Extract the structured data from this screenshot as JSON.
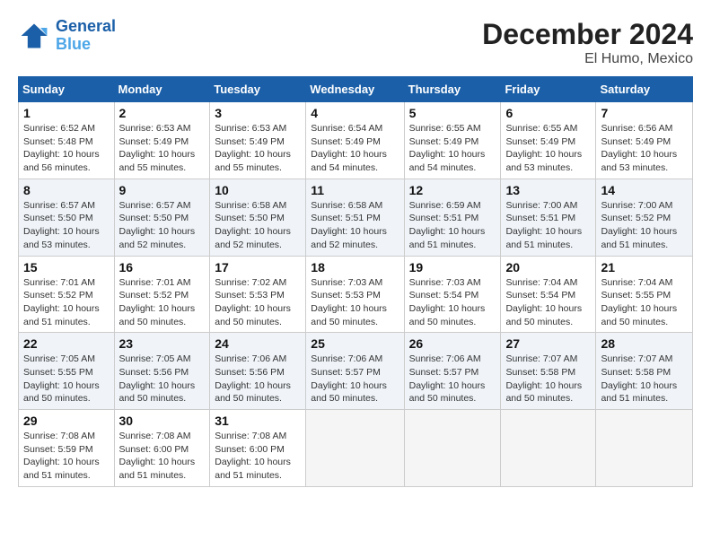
{
  "header": {
    "logo_line1": "General",
    "logo_line2": "Blue",
    "title": "December 2024",
    "subtitle": "El Humo, Mexico"
  },
  "days_of_week": [
    "Sunday",
    "Monday",
    "Tuesday",
    "Wednesday",
    "Thursday",
    "Friday",
    "Saturday"
  ],
  "weeks": [
    [
      {
        "day": 1,
        "sunrise": "6:52 AM",
        "sunset": "5:48 PM",
        "daylight": "10 hours and 56 minutes."
      },
      {
        "day": 2,
        "sunrise": "6:53 AM",
        "sunset": "5:49 PM",
        "daylight": "10 hours and 55 minutes."
      },
      {
        "day": 3,
        "sunrise": "6:53 AM",
        "sunset": "5:49 PM",
        "daylight": "10 hours and 55 minutes."
      },
      {
        "day": 4,
        "sunrise": "6:54 AM",
        "sunset": "5:49 PM",
        "daylight": "10 hours and 54 minutes."
      },
      {
        "day": 5,
        "sunrise": "6:55 AM",
        "sunset": "5:49 PM",
        "daylight": "10 hours and 54 minutes."
      },
      {
        "day": 6,
        "sunrise": "6:55 AM",
        "sunset": "5:49 PM",
        "daylight": "10 hours and 53 minutes."
      },
      {
        "day": 7,
        "sunrise": "6:56 AM",
        "sunset": "5:49 PM",
        "daylight": "10 hours and 53 minutes."
      }
    ],
    [
      {
        "day": 8,
        "sunrise": "6:57 AM",
        "sunset": "5:50 PM",
        "daylight": "10 hours and 53 minutes."
      },
      {
        "day": 9,
        "sunrise": "6:57 AM",
        "sunset": "5:50 PM",
        "daylight": "10 hours and 52 minutes."
      },
      {
        "day": 10,
        "sunrise": "6:58 AM",
        "sunset": "5:50 PM",
        "daylight": "10 hours and 52 minutes."
      },
      {
        "day": 11,
        "sunrise": "6:58 AM",
        "sunset": "5:51 PM",
        "daylight": "10 hours and 52 minutes."
      },
      {
        "day": 12,
        "sunrise": "6:59 AM",
        "sunset": "5:51 PM",
        "daylight": "10 hours and 51 minutes."
      },
      {
        "day": 13,
        "sunrise": "7:00 AM",
        "sunset": "5:51 PM",
        "daylight": "10 hours and 51 minutes."
      },
      {
        "day": 14,
        "sunrise": "7:00 AM",
        "sunset": "5:52 PM",
        "daylight": "10 hours and 51 minutes."
      }
    ],
    [
      {
        "day": 15,
        "sunrise": "7:01 AM",
        "sunset": "5:52 PM",
        "daylight": "10 hours and 51 minutes."
      },
      {
        "day": 16,
        "sunrise": "7:01 AM",
        "sunset": "5:52 PM",
        "daylight": "10 hours and 50 minutes."
      },
      {
        "day": 17,
        "sunrise": "7:02 AM",
        "sunset": "5:53 PM",
        "daylight": "10 hours and 50 minutes."
      },
      {
        "day": 18,
        "sunrise": "7:03 AM",
        "sunset": "5:53 PM",
        "daylight": "10 hours and 50 minutes."
      },
      {
        "day": 19,
        "sunrise": "7:03 AM",
        "sunset": "5:54 PM",
        "daylight": "10 hours and 50 minutes."
      },
      {
        "day": 20,
        "sunrise": "7:04 AM",
        "sunset": "5:54 PM",
        "daylight": "10 hours and 50 minutes."
      },
      {
        "day": 21,
        "sunrise": "7:04 AM",
        "sunset": "5:55 PM",
        "daylight": "10 hours and 50 minutes."
      }
    ],
    [
      {
        "day": 22,
        "sunrise": "7:05 AM",
        "sunset": "5:55 PM",
        "daylight": "10 hours and 50 minutes."
      },
      {
        "day": 23,
        "sunrise": "7:05 AM",
        "sunset": "5:56 PM",
        "daylight": "10 hours and 50 minutes."
      },
      {
        "day": 24,
        "sunrise": "7:06 AM",
        "sunset": "5:56 PM",
        "daylight": "10 hours and 50 minutes."
      },
      {
        "day": 25,
        "sunrise": "7:06 AM",
        "sunset": "5:57 PM",
        "daylight": "10 hours and 50 minutes."
      },
      {
        "day": 26,
        "sunrise": "7:06 AM",
        "sunset": "5:57 PM",
        "daylight": "10 hours and 50 minutes."
      },
      {
        "day": 27,
        "sunrise": "7:07 AM",
        "sunset": "5:58 PM",
        "daylight": "10 hours and 50 minutes."
      },
      {
        "day": 28,
        "sunrise": "7:07 AM",
        "sunset": "5:58 PM",
        "daylight": "10 hours and 51 minutes."
      }
    ],
    [
      {
        "day": 29,
        "sunrise": "7:08 AM",
        "sunset": "5:59 PM",
        "daylight": "10 hours and 51 minutes."
      },
      {
        "day": 30,
        "sunrise": "7:08 AM",
        "sunset": "6:00 PM",
        "daylight": "10 hours and 51 minutes."
      },
      {
        "day": 31,
        "sunrise": "7:08 AM",
        "sunset": "6:00 PM",
        "daylight": "10 hours and 51 minutes."
      },
      null,
      null,
      null,
      null
    ]
  ]
}
